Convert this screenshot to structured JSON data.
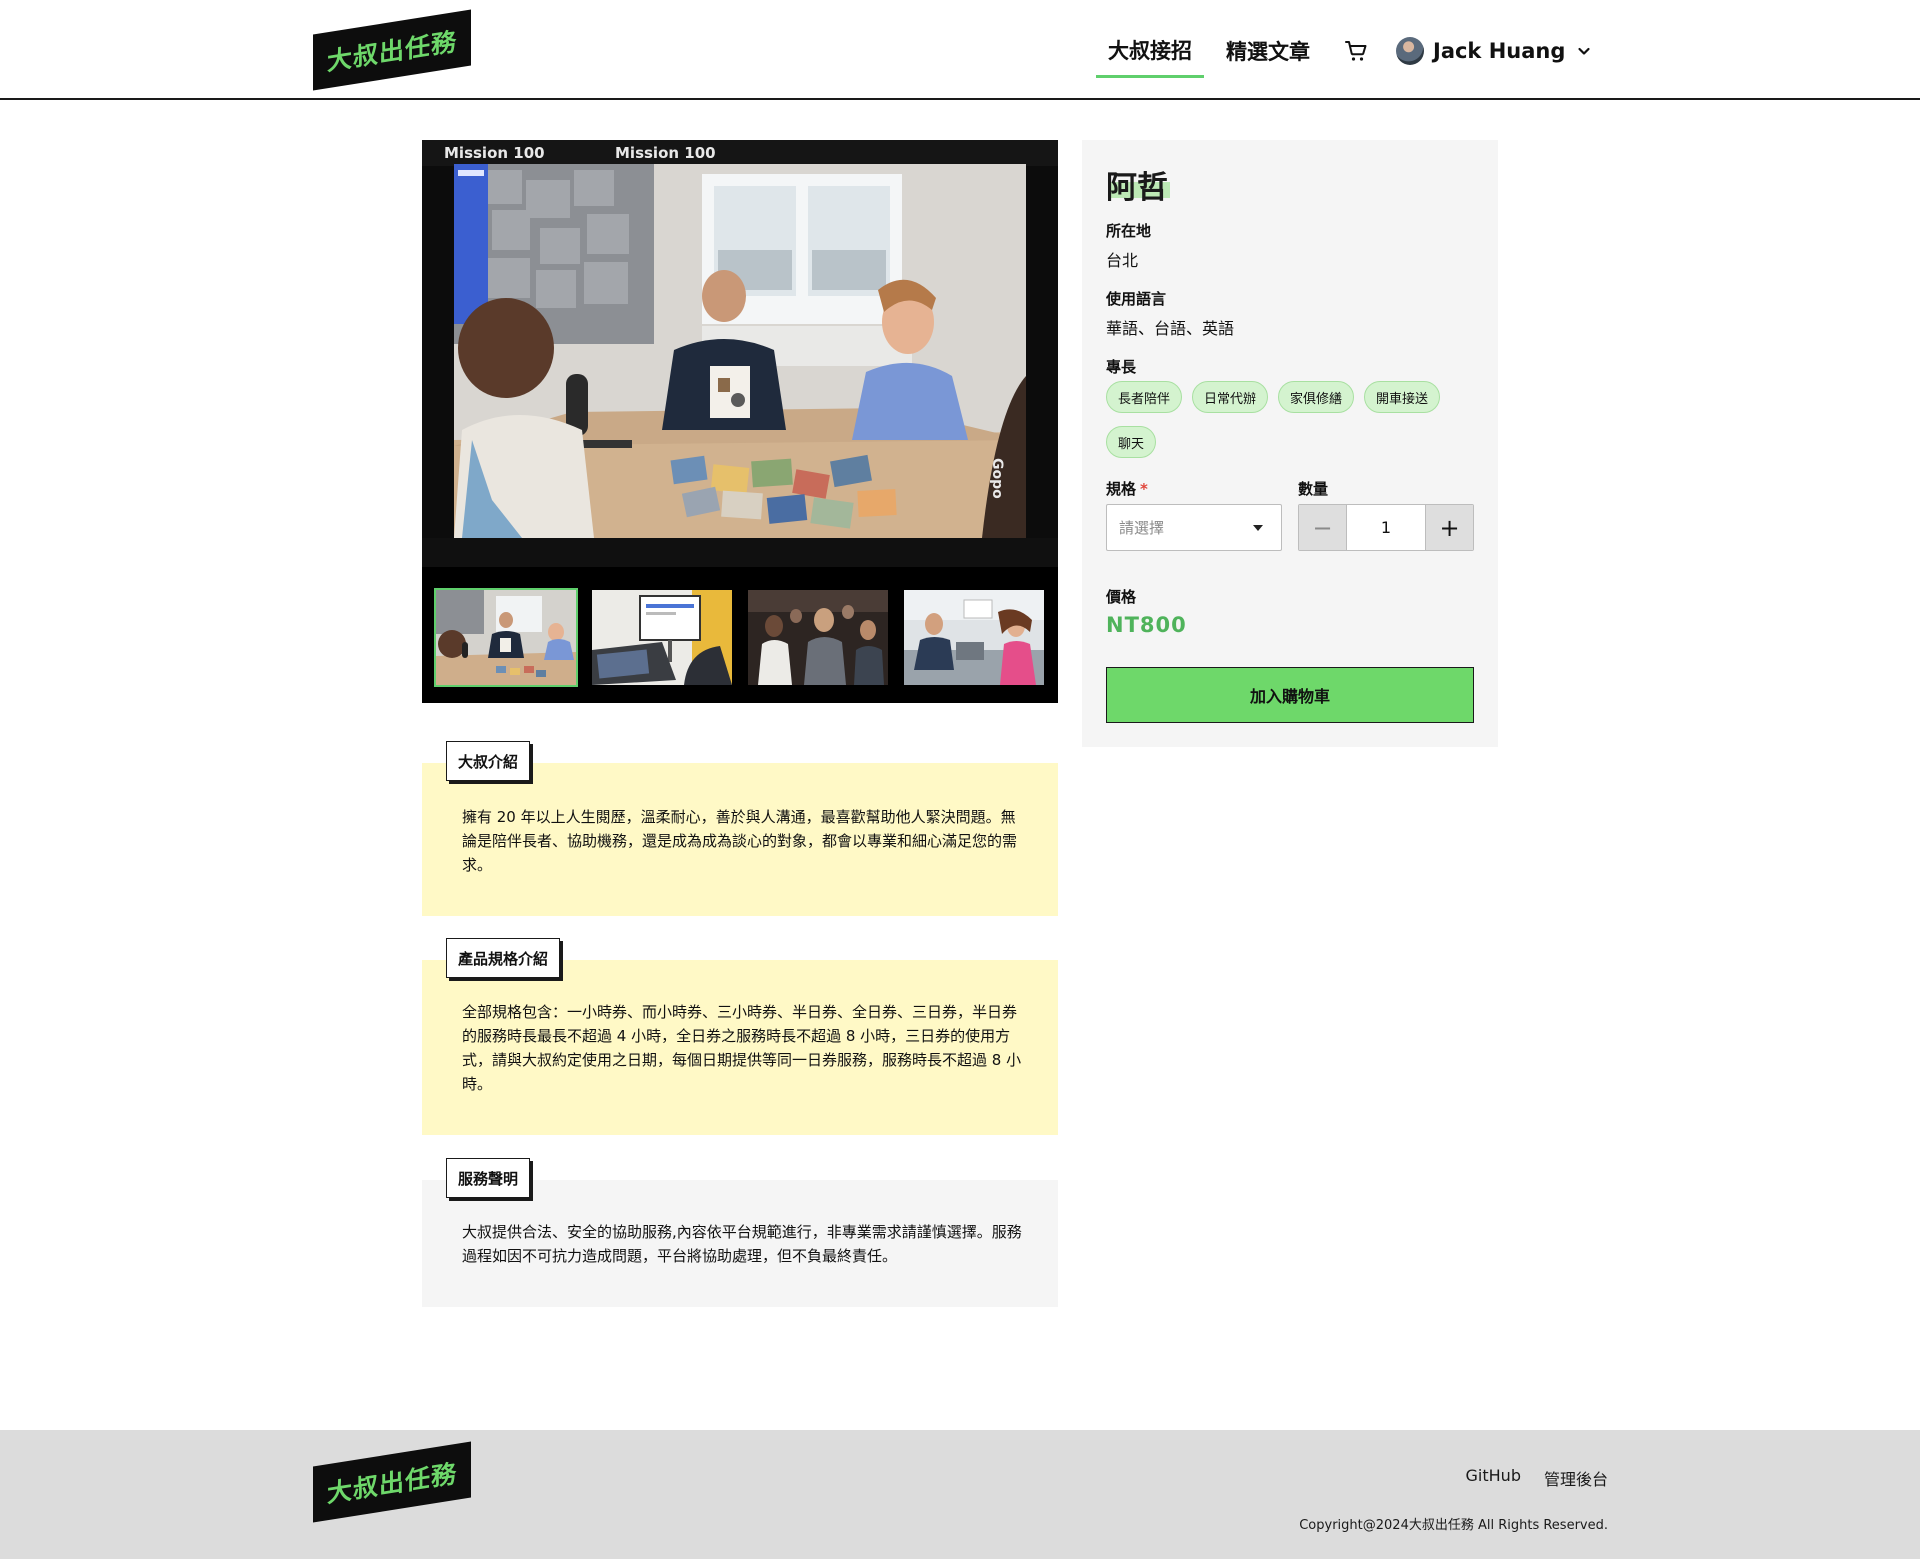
{
  "header": {
    "logo_text": "大叔出任務",
    "nav": [
      {
        "label": "大叔接招",
        "active": true
      },
      {
        "label": "精選文章",
        "active": false
      }
    ],
    "cart_icon": "shopping-cart-icon",
    "user": {
      "name": "Jack Huang",
      "menu_icon": "chevron-down-icon"
    }
  },
  "gallery": {
    "photo_texts": {
      "strip_left": "Mission 100",
      "strip_right": "Mission 100",
      "vertical": "Gopo"
    },
    "thumbnails": [
      {
        "selected": true
      },
      {
        "selected": false
      },
      {
        "selected": false
      },
      {
        "selected": false
      }
    ]
  },
  "product": {
    "name": "阿哲",
    "location_label": "所在地",
    "location": "台北",
    "language_label": "使用語言",
    "languages": "華語、台語、英語",
    "skills_label": "專長",
    "skills": [
      "長者陪伴",
      "日常代辦",
      "家俱修繕",
      "開車接送",
      "聊天"
    ],
    "spec_label": "規格",
    "spec_required_mark": "*",
    "spec_placeholder": "請選擇",
    "qty_label": "數量",
    "qty_value": "1",
    "qty_minus": "−",
    "qty_plus": "+",
    "price_label": "價格",
    "price": "NT800",
    "add_to_cart": "加入購物車",
    "accent_color": "#6ed86a"
  },
  "sections": {
    "intro": {
      "title": "大叔介紹",
      "text": "擁有 20 年以上人生閱歷，溫柔耐心，善於與人溝通，最喜歡幫助他人緊決問題。無論是陪伴長者、協助機務，還是成為成為談心的對象，都會以專業和細心滿足您的需求。"
    },
    "spec": {
      "title": "產品規格介紹",
      "text": "全部規格包含：一小時券、而小時券、三小時券、半日券、全日券、三日券，半日券的服務時長最長不超過 4 小時，全日券之服務時長不超過 8 小時，三日券的使用方式，請與大叔約定使用之日期，每個日期提供等同一日券服務，服務時長不超過 8 小時。"
    },
    "notice": {
      "title": "服務聲明",
      "text": "大叔提供合法、安全的協助服務,內容依平台規範進行，非專業需求請謹慎選擇。服務過程如因不可抗力造成問題，平台將協助處理，但不負最終責任。"
    }
  },
  "footer": {
    "logo_text": "大叔出任務",
    "links": [
      "GitHub",
      "管理後台"
    ],
    "copyright": "Copyright@2024大叔出任務 All Rights Reserved."
  }
}
